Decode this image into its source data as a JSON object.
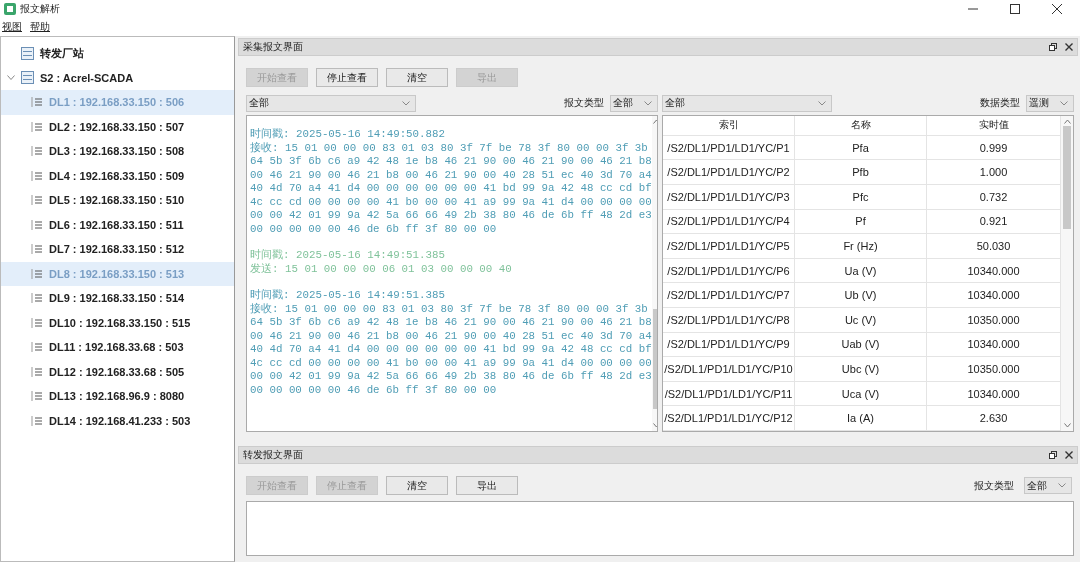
{
  "window": {
    "title": "报文解析"
  },
  "menu": [
    "视图",
    "帮助"
  ],
  "tree": [
    {
      "label": "转发厂站",
      "expanded": false,
      "selected": false
    },
    {
      "label": "S2 : Acrel-SCADA",
      "expanded": true,
      "selected": false,
      "children": [
        {
          "label": "DL1 : 192.168.33.150 : 506",
          "selected": true
        },
        {
          "label": "DL2 : 192.168.33.150 : 507",
          "selected": false
        },
        {
          "label": "DL3 : 192.168.33.150 : 508",
          "selected": false
        },
        {
          "label": "DL4 : 192.168.33.150 : 509",
          "selected": false
        },
        {
          "label": "DL5 : 192.168.33.150 : 510",
          "selected": false
        },
        {
          "label": "DL6 : 192.168.33.150 : 511",
          "selected": false
        },
        {
          "label": "DL7 : 192.168.33.150 : 512",
          "selected": false
        },
        {
          "label": "DL8 : 192.168.33.150 : 513",
          "selected": true
        },
        {
          "label": "DL9 : 192.168.33.150 : 514",
          "selected": false
        },
        {
          "label": "DL10 : 192.168.33.150 : 515",
          "selected": false
        },
        {
          "label": "DL11 : 192.168.33.68 : 503",
          "selected": false
        },
        {
          "label": "DL12 : 192.168.33.68 : 505",
          "selected": false
        },
        {
          "label": "DL13 : 192.168.96.9 : 8080",
          "selected": false
        },
        {
          "label": "DL14 : 192.168.41.233 : 503",
          "selected": false
        }
      ]
    }
  ],
  "collect_panel": {
    "title": "采集报文界面",
    "buttons": [
      {
        "label": "开始查看",
        "disabled": true
      },
      {
        "label": "停止查看",
        "disabled": false
      },
      {
        "label": "清空",
        "disabled": false
      },
      {
        "label": "导出",
        "disabled": true
      }
    ],
    "filter": "全部",
    "type_label": "报文类型",
    "type_value": "全部",
    "log": [
      {
        "kind": "recv",
        "lines": [
          "时间戳: 2025-05-16 14:49:50.882",
          "接收: 15 01 00 00 00 83 01 03 80 3f 7f be 78 3f 80 00 00 3f 3b",
          "64 5b 3f 6b c6 a9 42 48 1e b8 46 21 90 00 46 21 90 00 46 21 b8",
          "00 46 21 90 00 46 21 b8 00 46 21 90 00 40 28 51 ec 40 3d 70 a4",
          "40 4d 70 a4 41 d4 00 00 00 00 00 00 41 bd 99 9a 42 48 cc cd bf",
          "4c cc cd 00 00 00 00 41 b0 00 00 41 a9 99 9a 41 d4 00 00 00 00",
          "00 00 42 01 99 9a 42 5a 66 66 49 2b 38 80 46 de 6b ff 48 2d e3",
          "00 00 00 00 00 46 de 6b ff 3f 80 00 00"
        ]
      },
      {
        "kind": "send",
        "lines": [
          "时间戳: 2025-05-16 14:49:51.385",
          "发送: 15 01 00 00 00 06 01 03 00 00 00 40"
        ]
      },
      {
        "kind": "recv",
        "lines": [
          "时间戳: 2025-05-16 14:49:51.385",
          "接收: 15 01 00 00 00 83 01 03 80 3f 7f be 78 3f 80 00 00 3f 3b",
          "64 5b 3f 6b c6 a9 42 48 1e b8 46 21 90 00 46 21 90 00 46 21 b8",
          "00 46 21 90 00 46 21 b8 00 46 21 90 00 40 28 51 ec 40 3d 70 a4",
          "40 4d 70 a4 41 d4 00 00 00 00 00 00 41 bd 99 9a 42 48 cc cd bf",
          "4c cc cd 00 00 00 00 41 b0 00 00 41 a9 99 9a 41 d4 00 00 00 00",
          "00 00 42 01 99 9a 42 5a 66 66 49 2b 38 80 46 de 6b ff 48 2d e3",
          "00 00 00 00 00 46 de 6b ff 3f 80 00 00"
        ]
      }
    ],
    "table_filter": "全部",
    "data_type_label": "数据类型",
    "data_type_value": "遥测",
    "table": {
      "columns": [
        "索引",
        "名称",
        "实时值"
      ],
      "rows": [
        [
          "/S2/DL1/PD1/LD1/YC/P1",
          "Pfa",
          "0.999"
        ],
        [
          "/S2/DL1/PD1/LD1/YC/P2",
          "Pfb",
          "1.000"
        ],
        [
          "/S2/DL1/PD1/LD1/YC/P3",
          "Pfc",
          "0.732"
        ],
        [
          "/S2/DL1/PD1/LD1/YC/P4",
          "Pf",
          "0.921"
        ],
        [
          "/S2/DL1/PD1/LD1/YC/P5",
          "Fr (Hz)",
          "50.030"
        ],
        [
          "/S2/DL1/PD1/LD1/YC/P6",
          "Ua (V)",
          "10340.000"
        ],
        [
          "/S2/DL1/PD1/LD1/YC/P7",
          "Ub (V)",
          "10340.000"
        ],
        [
          "/S2/DL1/PD1/LD1/YC/P8",
          "Uc (V)",
          "10350.000"
        ],
        [
          "/S2/DL1/PD1/LD1/YC/P9",
          "Uab (V)",
          "10340.000"
        ],
        [
          "/S2/DL1/PD1/LD1/YC/P10",
          "Ubc (V)",
          "10350.000"
        ],
        [
          "/S2/DL1/PD1/LD1/YC/P11",
          "Uca (V)",
          "10340.000"
        ],
        [
          "/S2/DL1/PD1/LD1/YC/P12",
          "Ia (A)",
          "2.630"
        ]
      ]
    }
  },
  "forward_panel": {
    "title": "转发报文界面",
    "buttons": [
      {
        "label": "开始查看",
        "disabled": true
      },
      {
        "label": "停止查看",
        "disabled": true
      },
      {
        "label": "清空",
        "disabled": false
      },
      {
        "label": "导出",
        "disabled": false
      }
    ],
    "type_label": "报文类型",
    "type_value": "全部"
  }
}
